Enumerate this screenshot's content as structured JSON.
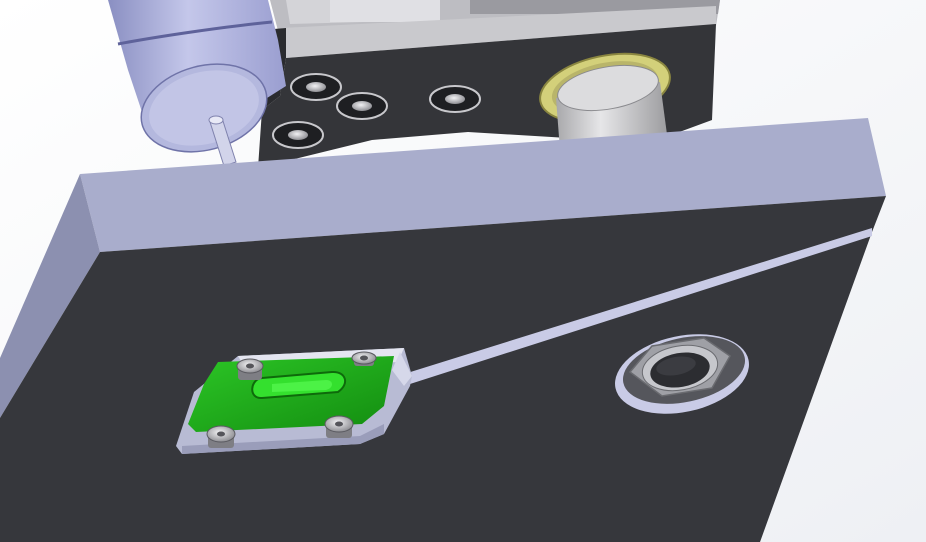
{
  "viewport": {
    "background_top": "#ffffff",
    "background_bottom": "#eef0f4"
  },
  "model": {
    "plate": {
      "face_color": "#36373c",
      "edge_color": "#a9adcc",
      "edge_dark_color": "#8c90b0"
    },
    "motor": {
      "color": "#b4b8de",
      "shaft_color": "#d2d4ea"
    },
    "upper_block": {
      "face_color": "#343539",
      "top_color": "#c9c9cd"
    },
    "bushing": {
      "ring_color": "#d3d07a",
      "cylinder_color": "#cfcfd1"
    },
    "pcb": {
      "color": "#1fa51a",
      "highlight_color": "#34e02e"
    },
    "fasteners": {
      "count_upper_block": 4,
      "count_pcb": 4,
      "color": "#c8c8cc"
    },
    "hex_nut": {
      "color": "#9fa0a6"
    }
  }
}
